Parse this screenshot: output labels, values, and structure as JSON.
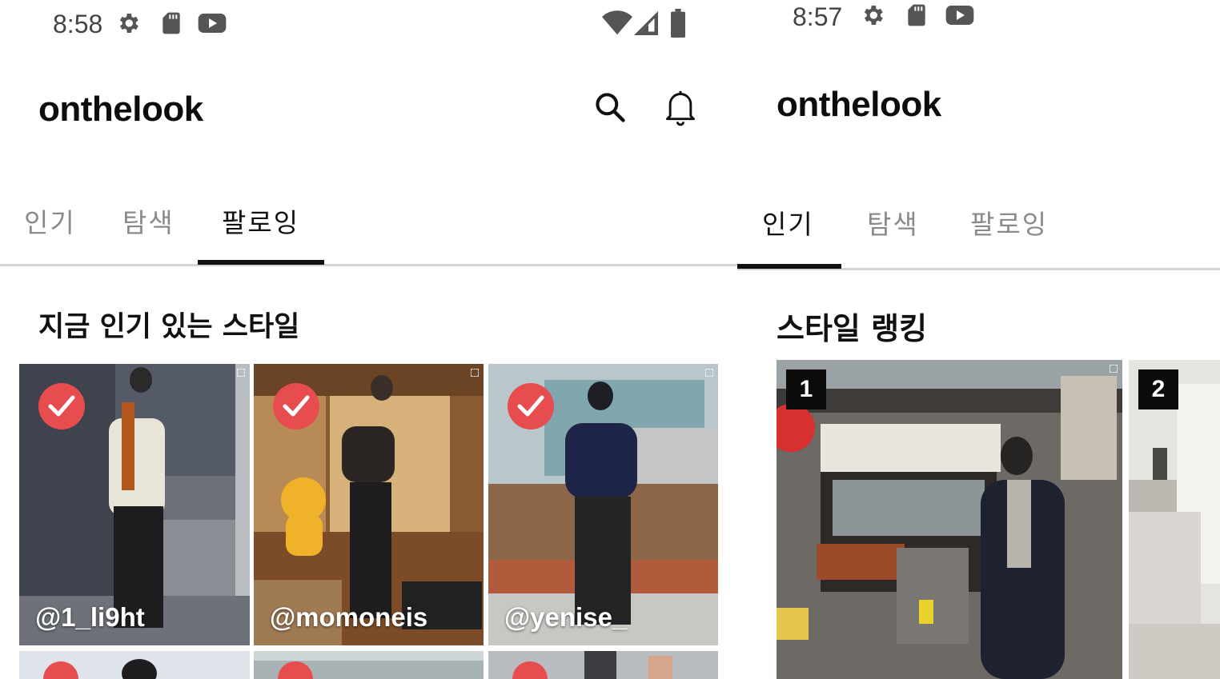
{
  "left_screen": {
    "status_bar": {
      "time": "8:58",
      "left_icons": [
        "gear-icon",
        "sd-card-icon",
        "youtube-icon"
      ],
      "right_icons": [
        "wifi-icon",
        "signal-icon",
        "battery-icon"
      ]
    },
    "app_title": "onthelook",
    "header_icons": [
      "search-icon",
      "bell-icon"
    ],
    "tabs": [
      {
        "label": "인기",
        "active": false
      },
      {
        "label": "탐색",
        "active": false
      },
      {
        "label": "팔로잉",
        "active": true
      }
    ],
    "section_title": "지금 인기 있는 스타일",
    "feed": [
      {
        "handle": "@1_li9ht",
        "checked": true
      },
      {
        "handle": "@momoneis",
        "checked": true
      },
      {
        "handle": "@yenise_",
        "checked": true
      }
    ]
  },
  "right_screen": {
    "status_bar": {
      "time": "8:57",
      "left_icons": [
        "gear-icon",
        "sd-card-icon",
        "youtube-icon"
      ]
    },
    "app_title": "onthelook",
    "tabs": [
      {
        "label": "인기",
        "active": true
      },
      {
        "label": "탐색",
        "active": false
      },
      {
        "label": "팔로잉",
        "active": false
      }
    ],
    "section_title": "스타일 랭킹",
    "ranking": [
      {
        "rank": "1"
      },
      {
        "rank": "2"
      }
    ]
  },
  "colors": {
    "check_badge": "#e74c4f",
    "active_tab": "#111111",
    "inactive_tab": "#8a8a8a",
    "rank_badge": "#0b0b0b"
  }
}
